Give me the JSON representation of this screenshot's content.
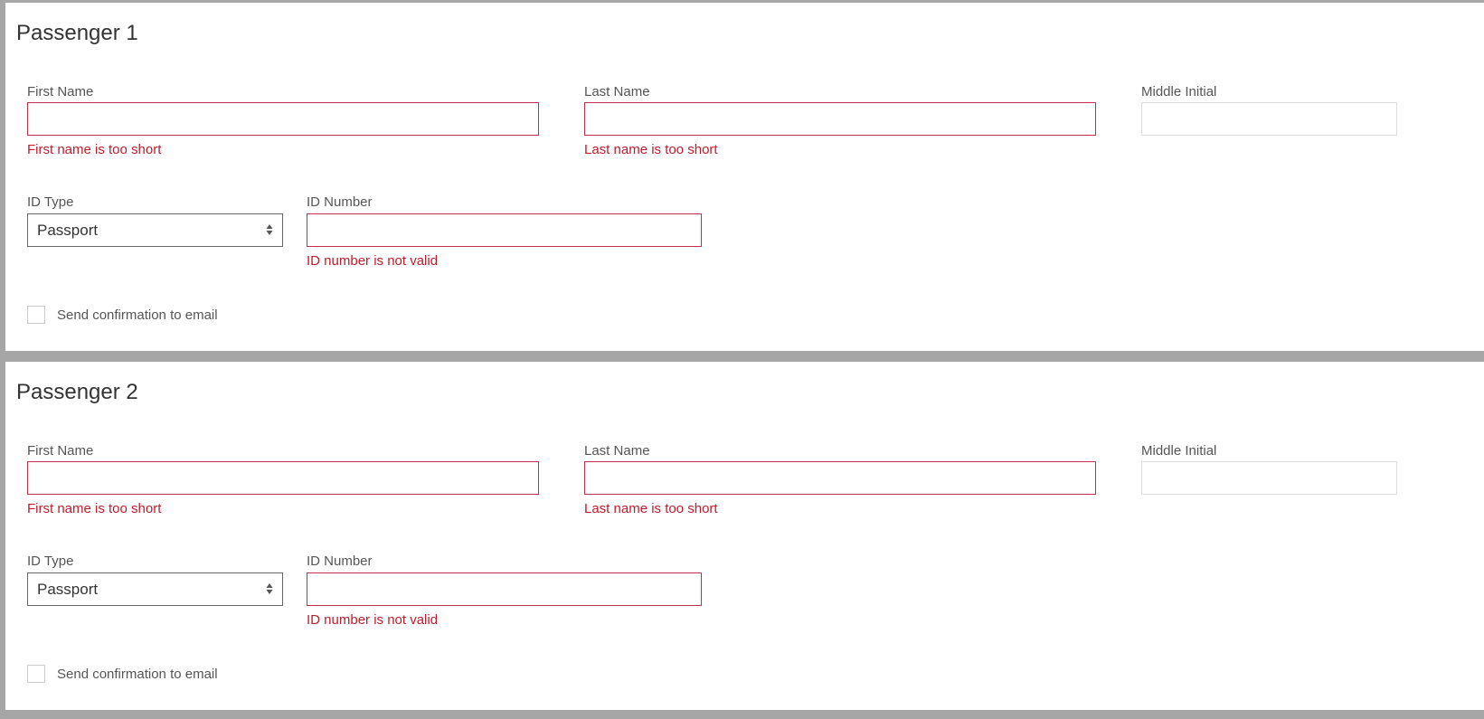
{
  "passengers": [
    {
      "title": "Passenger 1",
      "first_name": {
        "label": "First Name",
        "value": "",
        "error": "First name is too short"
      },
      "last_name": {
        "label": "Last Name",
        "value": "",
        "error": "Last name is too short"
      },
      "middle_initial": {
        "label": "Middle Initial",
        "value": ""
      },
      "id_type": {
        "label": "ID Type",
        "selected": "Passport"
      },
      "id_number": {
        "label": "ID Number",
        "value": "",
        "error": "ID number is not valid"
      },
      "send_confirmation": {
        "label": "Send confirmation to email",
        "checked": false
      }
    },
    {
      "title": "Passenger 2",
      "first_name": {
        "label": "First Name",
        "value": "",
        "error": "First name is too short"
      },
      "last_name": {
        "label": "Last Name",
        "value": "",
        "error": "Last name is too short"
      },
      "middle_initial": {
        "label": "Middle Initial",
        "value": ""
      },
      "id_type": {
        "label": "ID Type",
        "selected": "Passport"
      },
      "id_number": {
        "label": "ID Number",
        "value": "",
        "error": "ID number is not valid"
      },
      "send_confirmation": {
        "label": "Send confirmation to email",
        "checked": false
      }
    }
  ],
  "colors": {
    "background": "#a6a6a6",
    "error": "#c01c2c",
    "error_border": "#c0304a",
    "label": "#555555"
  },
  "icons": {
    "select_arrows": "sort-arrows-icon"
  }
}
